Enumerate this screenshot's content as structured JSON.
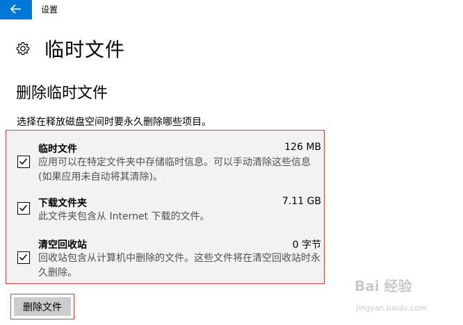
{
  "window": {
    "title": "设置"
  },
  "page": {
    "title": "临时文件",
    "section_title": "删除临时文件",
    "instruction": "选择在释放磁盘空间时要永久删除哪些项目。"
  },
  "items": [
    {
      "name": "临时文件",
      "size": "126 MB",
      "description": "应用可以在特定文件夹中存储临时信息。可以手动清除这些信息(如果应用未自动将其清除)。",
      "checked": true
    },
    {
      "name": "下载文件夹",
      "size": "7.11 GB",
      "description": "此文件夹包含从 Internet 下载的文件。",
      "checked": true
    },
    {
      "name": "清空回收站",
      "size": "0 字节",
      "description": "回收站包含从计算机中删除的文件。这些文件将在清空回收站时永久删除。",
      "checked": true
    }
  ],
  "actions": {
    "delete_label": "删除文件"
  },
  "watermark": {
    "logo": "Bai 经验",
    "url": "jingyan.baidu.com"
  },
  "colors": {
    "accent": "#0078d7",
    "highlight_border": "#e0393e",
    "list_bg": "#f2f2f2",
    "button_bg": "#cccccc"
  }
}
